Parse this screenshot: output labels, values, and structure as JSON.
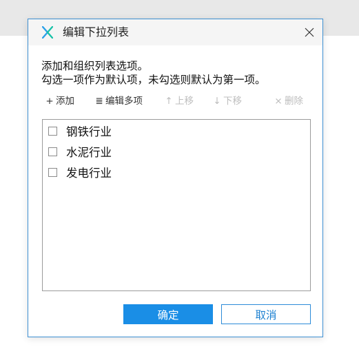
{
  "dialog": {
    "title": "编辑下拉列表",
    "app_icon": "x-logo-icon",
    "description_line1": "添加和组织列表选项。",
    "description_line2": "勾选一项作为默认项，未勾选则默认为第一项。"
  },
  "toolbar": {
    "add": {
      "icon": "+",
      "label": "添加",
      "enabled": true
    },
    "edit_multi": {
      "icon": "≣",
      "label": "编辑多项",
      "enabled": true
    },
    "move_up": {
      "icon": "↑",
      "label": "上移",
      "enabled": false
    },
    "move_down": {
      "icon": "↓",
      "label": "下移",
      "enabled": false
    },
    "delete": {
      "icon": "×",
      "label": "删除",
      "enabled": false
    }
  },
  "list": {
    "items": [
      {
        "label": "钢铁行业",
        "checked": false
      },
      {
        "label": "水泥行业",
        "checked": false
      },
      {
        "label": "发电行业",
        "checked": false
      }
    ]
  },
  "buttons": {
    "ok_label": "确定",
    "cancel_label": "取消"
  },
  "colors": {
    "accent": "#1a8ee6",
    "border": "#3c8fd2",
    "disabled_text": "#bdbdbd"
  }
}
